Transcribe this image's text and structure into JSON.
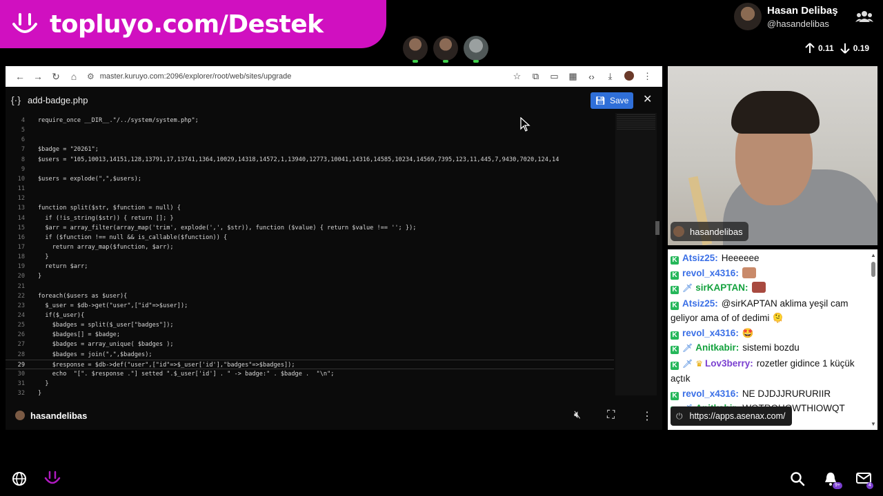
{
  "banner": {
    "text": "topluyo.com/Destek"
  },
  "streamer": {
    "name": "Hasan Delibaş",
    "handle": "@hasandelibas"
  },
  "net": {
    "up": "0.11",
    "down": "0.19"
  },
  "browser": {
    "url": "master.kuruyo.com:2096/explorer/root/web/sites/upgrade"
  },
  "editor": {
    "filename": "add-badge.php",
    "save_label": "Save",
    "lines": [
      {
        "n": "4",
        "t": "require_once __DIR__.\"/../system/system.php\";"
      },
      {
        "n": "5",
        "t": ""
      },
      {
        "n": "6",
        "t": ""
      },
      {
        "n": "7",
        "t": "$badge = \"20261\";"
      },
      {
        "n": "8",
        "t": "$users = \"105,10013,14151,128,13791,17,13741,1364,10029,14318,14572,1,13940,12773,10041,14316,14585,10234,14569,7395,123,11,445,7,9430,7020,124,14"
      },
      {
        "n": "9",
        "t": ""
      },
      {
        "n": "10",
        "t": "$users = explode(\",\",$users);"
      },
      {
        "n": "11",
        "t": ""
      },
      {
        "n": "12",
        "t": ""
      },
      {
        "n": "13",
        "t": "function split($str, $function = null) {"
      },
      {
        "n": "14",
        "t": "  if (!is_string($str)) { return []; }"
      },
      {
        "n": "15",
        "t": "  $arr = array_filter(array_map('trim', explode(',', $str)), function ($value) { return $value !== ''; });"
      },
      {
        "n": "16",
        "t": "  if ($function !== null && is_callable($function)) {"
      },
      {
        "n": "17",
        "t": "    return array_map($function, $arr);"
      },
      {
        "n": "18",
        "t": "  }"
      },
      {
        "n": "19",
        "t": "  return $arr;"
      },
      {
        "n": "20",
        "t": "}"
      },
      {
        "n": "21",
        "t": ""
      },
      {
        "n": "22",
        "t": "foreach($users as $user){"
      },
      {
        "n": "23",
        "t": "  $_user = $db->get(\"user\",[\"id\"=>$user]);"
      },
      {
        "n": "24",
        "t": "  if($_user){"
      },
      {
        "n": "25",
        "t": "    $badges = split($_user[\"badges\"]);"
      },
      {
        "n": "26",
        "t": "    $badges[] = $badge;"
      },
      {
        "n": "27",
        "t": "    $badges = array_unique( $badges );"
      },
      {
        "n": "28",
        "t": "    $badges = join(\",\",$badges);"
      },
      {
        "n": "29",
        "t": "    $response = $db->def(\"user\",[\"id\"=>$_user['id'],\"badges\"=>$badges]);"
      },
      {
        "n": "30",
        "t": "    echo  \"[\". $response .\"] setted \".$_user['id'] . \" -> badge:\" . $badge .  \"\\n\";"
      },
      {
        "n": "31",
        "t": "  }"
      },
      {
        "n": "32",
        "t": "}"
      }
    ]
  },
  "overlay": {
    "name": "hasandelibas"
  },
  "cam": {
    "label": "hasandelibas"
  },
  "chat": {
    "messages": [
      {
        "user": "Atsiz25:",
        "text": "Heeeeee",
        "color": "blue"
      },
      {
        "user": "revol_x4316:",
        "text": "",
        "color": "blue",
        "emote": true
      },
      {
        "user": "sirKAPTAN:",
        "text": "",
        "color": "green",
        "mod": true,
        "emote": true,
        "emote_red": true
      },
      {
        "user": "Atsiz25:",
        "text": "@sirKAPTAN aklima yeşil cam geliyor ama of of dedimi 🫠",
        "color": "blue"
      },
      {
        "user": "revol_x4316:",
        "text": "🤩",
        "color": "blue"
      },
      {
        "user": "Anitkabir:",
        "text": "sistemi bozdu",
        "color": "green",
        "mod": true
      },
      {
        "user": "Lov3berry:",
        "text": "rozetler gidince 1 küçük açtık",
        "color": "purple",
        "mod": true,
        "crown": true
      },
      {
        "user": "revol_x4316:",
        "text": "NE DJDJJRURURIIR",
        "color": "blue"
      },
      {
        "user": "Anitkabir:",
        "text": "WQTRQHQWTHIOWQT",
        "color": "green",
        "mod": true
      }
    ]
  },
  "tooltip": {
    "url": "https://apps.asenax.com/"
  },
  "notifications": {
    "bell_count": "9+",
    "mail_count": "4"
  },
  "icons": [
    "smile-logo-icon",
    "people-icon",
    "arrow-up-icon",
    "arrow-down-icon",
    "back-icon",
    "forward-icon",
    "reload-icon",
    "home-icon",
    "star-icon",
    "extension-icon",
    "cast-icon",
    "qr-icon",
    "code-icon",
    "download-icon",
    "more-icon",
    "save-icon",
    "close-icon",
    "mute-icon",
    "fullscreen-icon",
    "globe-icon",
    "search-icon",
    "bell-icon",
    "mail-icon"
  ]
}
